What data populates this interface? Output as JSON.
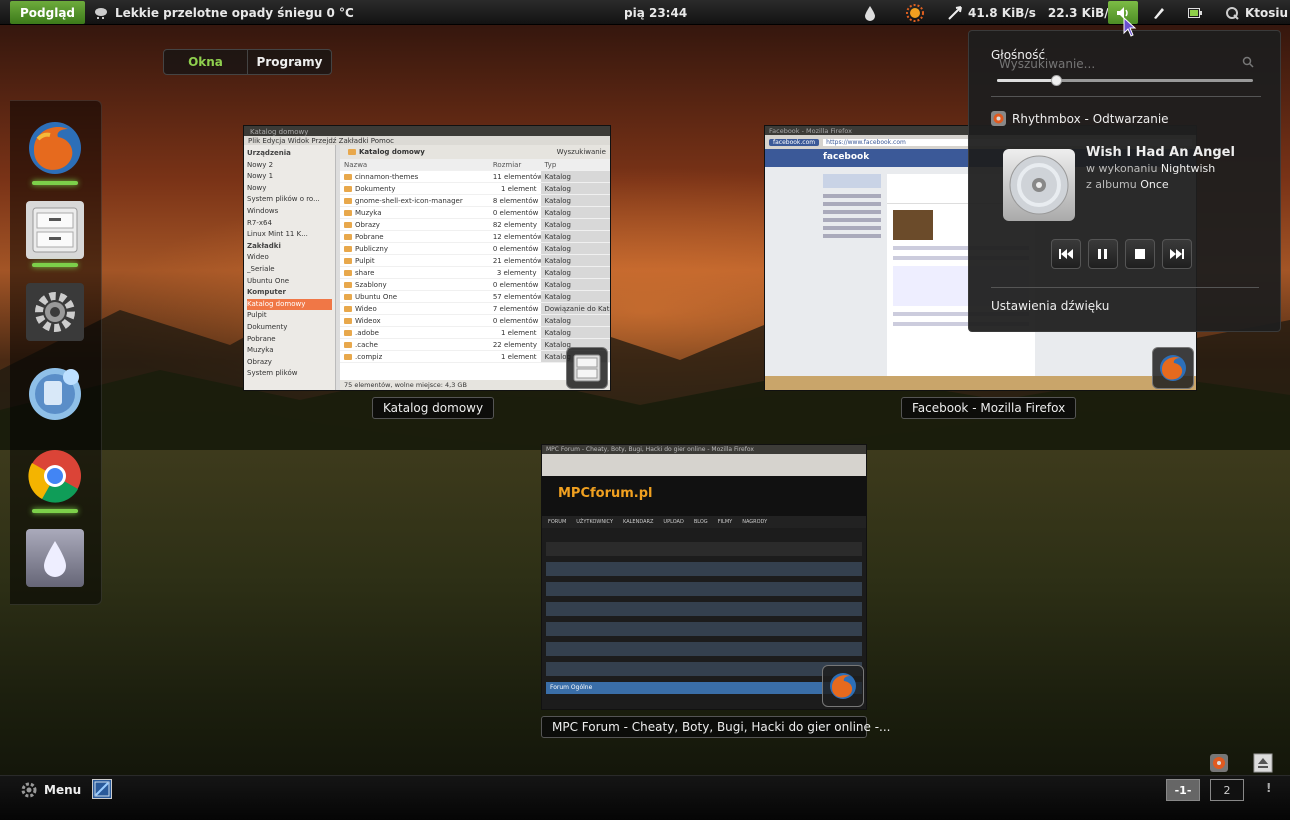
{
  "top_panel": {
    "activities": "Podgląd",
    "weather": "Lekkie przelotne opady śniegu 0 °C",
    "clock": "pią 23:44",
    "net_down": "41.8 KiB/s",
    "net_up": "22.3 KiB/s",
    "user": "Ktosiu"
  },
  "view_tabs": {
    "windows": "Okna",
    "applications": "Programy"
  },
  "windows": {
    "files": {
      "caption": "Katalog domowy",
      "title": "Katalog domowy",
      "menu": "Plik  Edycja  Widok  Przejdź  Zakładki  Pomoc",
      "location": "Katalog domowy",
      "search": "Wyszukiwanie",
      "sidebar": [
        {
          "label": "Urządzenia",
          "hdr": true
        },
        {
          "label": "Nowy 2"
        },
        {
          "label": "Nowy 1"
        },
        {
          "label": "Nowy"
        },
        {
          "label": "System plików o ro..."
        },
        {
          "label": "Windows"
        },
        {
          "label": "R7-x64"
        },
        {
          "label": "Linux Mint 11 K..."
        },
        {
          "label": "Zakładki",
          "hdr": true
        },
        {
          "label": "Wideo"
        },
        {
          "label": "_Seriale"
        },
        {
          "label": "Ubuntu One"
        },
        {
          "label": "Komputer",
          "hdr": true
        },
        {
          "label": "Katalog domowy",
          "sel": true
        },
        {
          "label": "Pulpit"
        },
        {
          "label": "Dokumenty"
        },
        {
          "label": "Pobrane"
        },
        {
          "label": "Muzyka"
        },
        {
          "label": "Obrazy"
        },
        {
          "label": "System plików"
        }
      ],
      "columns": [
        "Nazwa",
        "Rozmiar",
        "Typ"
      ],
      "rows": [
        [
          "cinnamon-themes",
          "11 elementów",
          "Katalog"
        ],
        [
          "Dokumenty",
          "1 element",
          "Katalog"
        ],
        [
          "gnome-shell-ext-icon-manager",
          "8 elementów",
          "Katalog"
        ],
        [
          "Muzyka",
          "0 elementów",
          "Katalog"
        ],
        [
          "Obrazy",
          "82 elementy",
          "Katalog"
        ],
        [
          "Pobrane",
          "12 elementów",
          "Katalog"
        ],
        [
          "Publiczny",
          "0 elementów",
          "Katalog"
        ],
        [
          "Pulpit",
          "21 elementów",
          "Katalog"
        ],
        [
          "share",
          "3 elementy",
          "Katalog"
        ],
        [
          "Szablony",
          "0 elementów",
          "Katalog"
        ],
        [
          "Ubuntu One",
          "57 elementów",
          "Katalog"
        ],
        [
          "Wideo",
          "7 elementów",
          "Dowiązanie do Kata"
        ],
        [
          "Wideox",
          "0 elementów",
          "Katalog"
        ],
        [
          ".adobe",
          "1 element",
          "Katalog"
        ],
        [
          ".cache",
          "22 elementy",
          "Katalog"
        ],
        [
          ".compiz",
          "1 element",
          "Katalog"
        ]
      ],
      "status": "75 elementów, wolne miejsce: 4,3 GB"
    },
    "facebook": {
      "caption": "Facebook - Mozilla Firefox",
      "title": "Facebook - Mozilla Firefox",
      "url": "facebook.com",
      "url_full": "https://www.facebook.com",
      "logo": "facebook"
    },
    "mpc": {
      "caption": "MPC Forum - Cheaty, Boty, Bugi, Hacki do gier online -...",
      "title": "MPC Forum - Cheaty, Boty, Bugi, Hacki do gier online - Mozilla Firefox",
      "logo": "MPCforum.pl",
      "nav": [
        "FORUM",
        "UŻYTKOWNICY",
        "KALENDARZ",
        "UPLOAD",
        "BLOG",
        "FILMY",
        "NAGRODY"
      ],
      "forum_row": "Forum Ogólne"
    }
  },
  "sound_menu": {
    "volume_label": "Głośność",
    "search_placeholder": "Wyszukiwanie...",
    "volume_level": 0.23,
    "player_name": "Rhythmbox - Odtwarzanie",
    "track_title": "Wish I Had An Angel",
    "artist_prefix": "w wykonaniu",
    "artist": "Nightwish",
    "album_prefix": "z albumu",
    "album": "Once",
    "settings": "Ustawienia dźwięku"
  },
  "bottom_panel": {
    "menu": "Menu",
    "workspaces": [
      "-1-",
      "2"
    ],
    "alert": "!"
  },
  "colors": {
    "accent": "#6dab3c",
    "selection": "#f07746"
  }
}
